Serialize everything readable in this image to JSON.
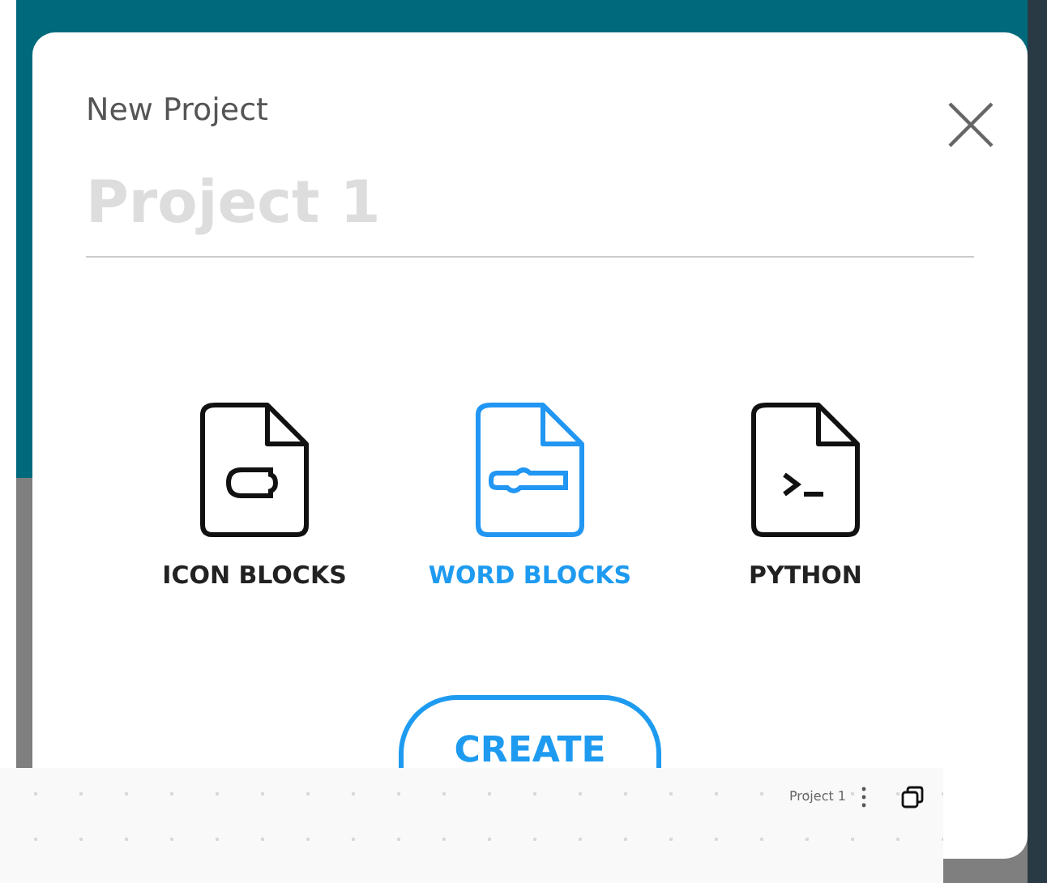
{
  "dialog": {
    "title": "New Project",
    "name_field": {
      "placeholder": "Project 1"
    },
    "project_types": [
      {
        "kind": "icon",
        "label": "ICON BLOCKS",
        "selected": false
      },
      {
        "kind": "word",
        "label": "WORD BLOCKS",
        "selected": true
      },
      {
        "kind": "python",
        "label": "PYTHON",
        "selected": false
      }
    ],
    "create_button": "CREATE"
  },
  "workspace_bar": {
    "project_name": "Project 1"
  }
}
